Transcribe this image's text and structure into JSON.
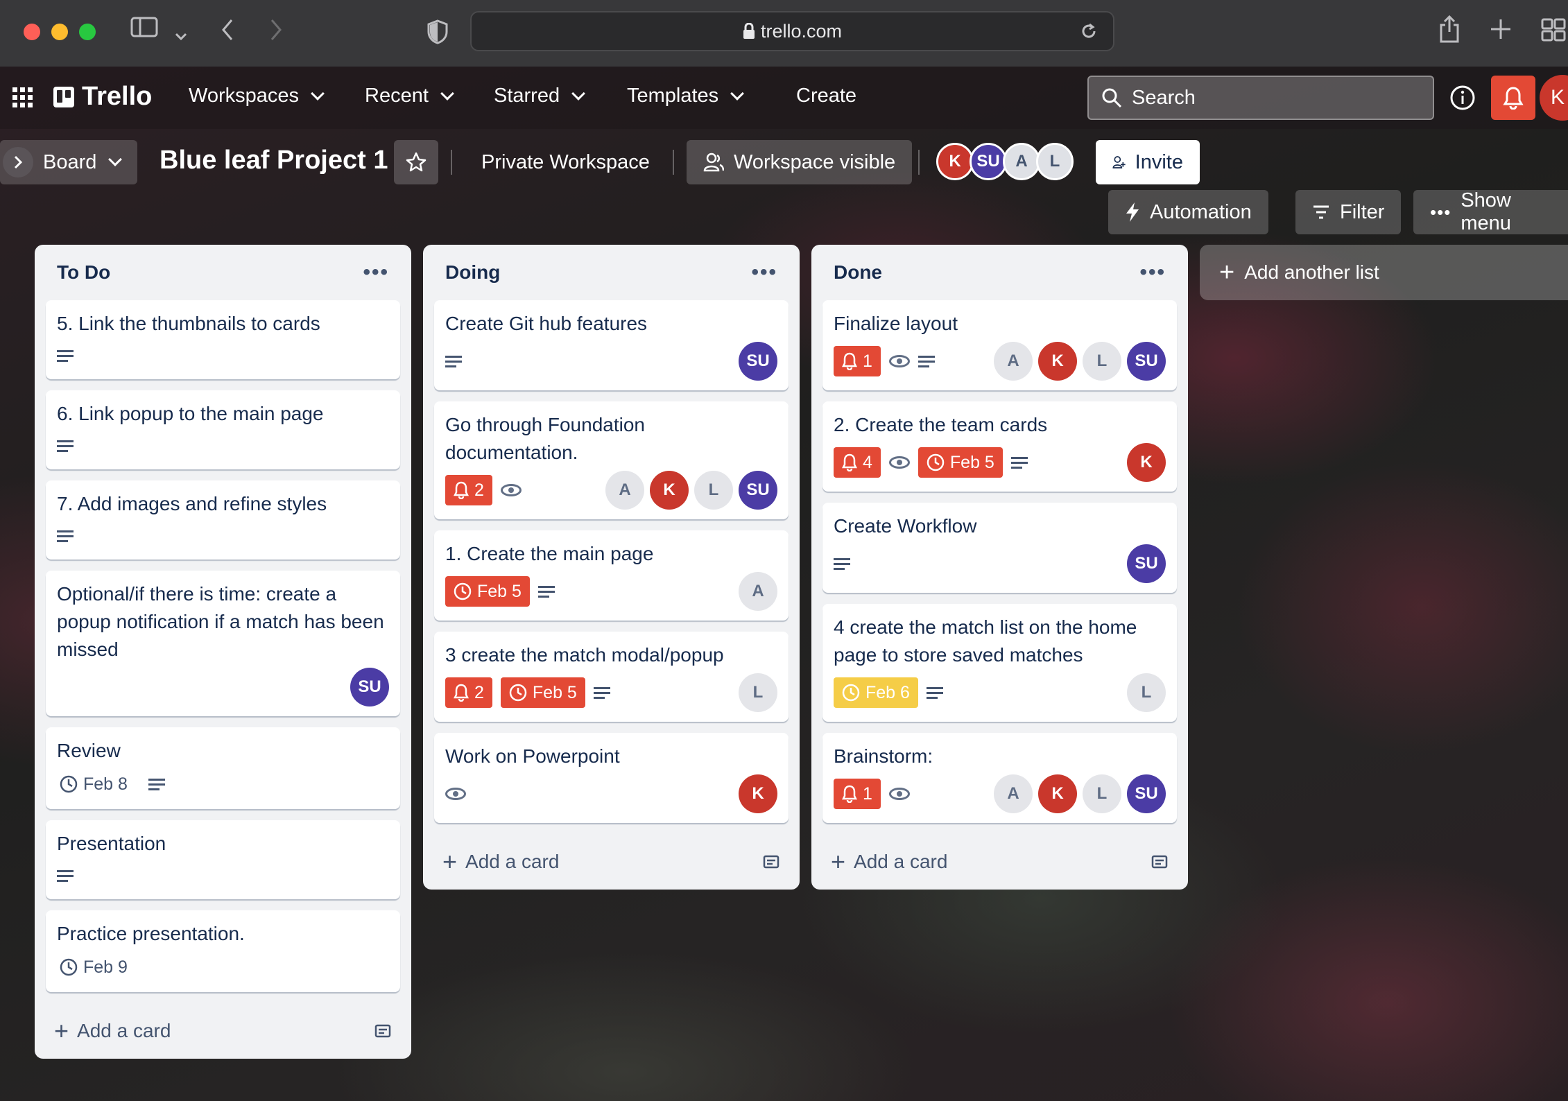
{
  "browser": {
    "url": "trello.com"
  },
  "nav": {
    "logo": "Trello",
    "workspaces": "Workspaces",
    "recent": "Recent",
    "starred": "Starred",
    "templates": "Templates",
    "create": "Create",
    "search_placeholder": "Search",
    "user_initial": "K"
  },
  "board": {
    "view": "Board",
    "title": "Blue leaf Project 1",
    "workspace": "Private Workspace",
    "visibility": "Workspace visible",
    "members": [
      "K",
      "SU",
      "A",
      "L"
    ],
    "invite": "Invite",
    "automation": "Automation",
    "filter": "Filter",
    "show_menu": "Show menu"
  },
  "lists": [
    {
      "title": "To Do",
      "add_card": "Add a card",
      "cards": [
        {
          "title": "5. Link the thumbnails to cards"
        },
        {
          "title": "6. Link popup to the main page"
        },
        {
          "title": "7. Add images and refine styles"
        },
        {
          "title": "Optional/if there is time: create a popup notification if a match has been missed",
          "members": [
            "SU"
          ]
        },
        {
          "title": "Review",
          "due": "Feb 8"
        },
        {
          "title": "Presentation"
        },
        {
          "title": "Practice presentation.",
          "due": "Feb 9"
        }
      ]
    },
    {
      "title": "Doing",
      "add_card": "Add a card",
      "cards": [
        {
          "title": "Create Git hub features",
          "members": [
            "SU"
          ]
        },
        {
          "title": "Go through Foundation documentation.",
          "notifications": "2",
          "members": [
            "A",
            "K",
            "L",
            "SU"
          ]
        },
        {
          "title": "1. Create the main page",
          "due": "Feb 5",
          "members": [
            "A"
          ]
        },
        {
          "title": "3 create the match modal/popup",
          "notifications": "2",
          "due": "Feb 5",
          "members": [
            "L"
          ]
        },
        {
          "title": "Work on Powerpoint",
          "members": [
            "K"
          ]
        }
      ]
    },
    {
      "title": "Done",
      "add_card": "Add a card",
      "cards": [
        {
          "title": "Finalize layout",
          "notifications": "1",
          "members": [
            "A",
            "K",
            "L",
            "SU"
          ]
        },
        {
          "title": "2. Create the team cards",
          "notifications": "4",
          "due": "Feb 5",
          "members": [
            "K"
          ]
        },
        {
          "title": "Create Workflow",
          "members": [
            "SU"
          ]
        },
        {
          "title": "4 create the match list on the home page to store saved matches",
          "due": "Feb 6",
          "members": [
            "L"
          ]
        },
        {
          "title": "Brainstorm:",
          "notifications": "1",
          "members": [
            "A",
            "K",
            "L",
            "SU"
          ]
        }
      ]
    }
  ],
  "add_list": "Add another list",
  "colors": {
    "red_badge": "#e34935",
    "yellow_badge": "#f5cd47",
    "avatar_k": "#c9372c",
    "avatar_su": "#4b3ca5"
  }
}
